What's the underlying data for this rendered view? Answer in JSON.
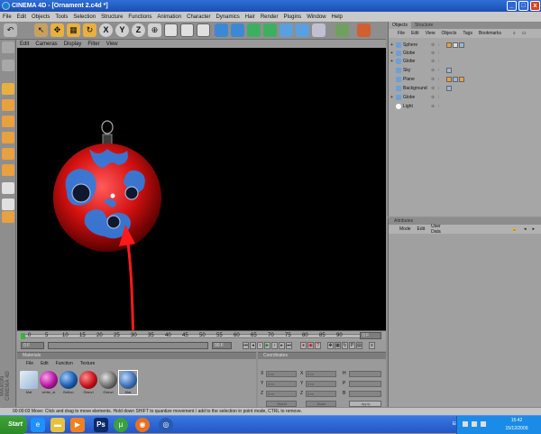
{
  "window": {
    "title": "CINEMA 4D - [Ornament 2.c4d *]",
    "min": "_",
    "max": "□",
    "close": "x"
  },
  "menu": [
    "File",
    "Edit",
    "Objects",
    "Tools",
    "Selection",
    "Structure",
    "Functions",
    "Animation",
    "Character",
    "Dynamics",
    "Hair",
    "Render",
    "Plugins",
    "Window",
    "Help"
  ],
  "toolbar": {
    "undo": "↶",
    "live_select": "↖",
    "move": "✥",
    "scale": "▦",
    "rotate": "↻",
    "x_axis": "X",
    "y_axis": "Y",
    "z_axis": "Z",
    "world": "⊕"
  },
  "viewport": {
    "menu": [
      "Edit",
      "Cameras",
      "Display",
      "Filter",
      "View"
    ]
  },
  "timeline": {
    "ticks": [
      "0",
      "5",
      "10",
      "15",
      "20",
      "25",
      "30",
      "35",
      "40",
      "45",
      "50",
      "55",
      "60",
      "65",
      "70",
      "75",
      "80",
      "85",
      "90"
    ],
    "frame": "0 F"
  },
  "playback": {
    "start_field": "0 F",
    "end_field": "90 F"
  },
  "materials": {
    "title": "Materials",
    "menu": [
      "File",
      "Edit",
      "Function",
      "Texture"
    ],
    "items": [
      {
        "label": "Mat",
        "color": "#9ab6d6"
      },
      {
        "label": "white_st",
        "color": "#b0159c"
      },
      {
        "label": "Button",
        "color": "#1a59a8"
      },
      {
        "label": "Glanzl",
        "color": "#c4111b"
      },
      {
        "label": "Glanzl",
        "color": "#6e6e6e"
      },
      {
        "label": "Mat",
        "color": "#3d6fb0"
      }
    ]
  },
  "coordinates": {
    "title": "Coordinates",
    "rows": [
      {
        "a": "X",
        "b": "X",
        "c": "H",
        "v": "0 m"
      },
      {
        "a": "Y",
        "b": "Y",
        "c": "P",
        "v": "0 m"
      },
      {
        "a": "Z",
        "b": "Z",
        "c": "B",
        "v": "0 m"
      }
    ],
    "mode1": "World",
    "mode2": "Scale",
    "apply": "Apply"
  },
  "objects": {
    "tabs": [
      "Objects",
      "Structure"
    ],
    "menu": [
      "File",
      "Edit",
      "View",
      "Objects",
      "Tags",
      "Bookmarks"
    ],
    "rows": [
      {
        "name": "Sphere",
        "icon": "#6ba0d8",
        "flags": "⊕ ⁝"
      },
      {
        "name": "Globe",
        "icon": "#6ba0d8",
        "flags": "⊕ ⁝"
      },
      {
        "name": "Globe",
        "icon": "#6ba0d8",
        "flags": "⊕ ⁝"
      },
      {
        "name": "Sky",
        "icon": "#6ba0d8",
        "flags": "⊕ ⁝"
      },
      {
        "name": "Plane",
        "icon": "#6ba0d8",
        "flags": "⊕ ⁝"
      },
      {
        "name": "Background",
        "icon": "#6ba0d8",
        "flags": "⊕ ⁝"
      },
      {
        "name": "Globe",
        "icon": "#6ba0d8",
        "flags": "⊕ ⁝"
      },
      {
        "name": "Light",
        "icon": "#ffffff",
        "flags": "⊕ ⁝"
      }
    ]
  },
  "attributes": {
    "title": "Attributes",
    "menu": [
      "Mode",
      "Edit",
      "User Data"
    ]
  },
  "status": {
    "text": "00:00:03   Move: Click and drag to move elements. Hold down SHIFT to quantize movement / add to the selection in point mode, CTRL to remove."
  },
  "branding": "MAXON CINEMA 4D",
  "taskbar": {
    "start": "Start",
    "lang": "EN",
    "time": "15:42",
    "date": "15/12/2009",
    "ps": "Ps"
  },
  "colors": {
    "ornament": "#d41111",
    "pattern": "#2f7de0",
    "arrow": "#ff1a1a"
  }
}
